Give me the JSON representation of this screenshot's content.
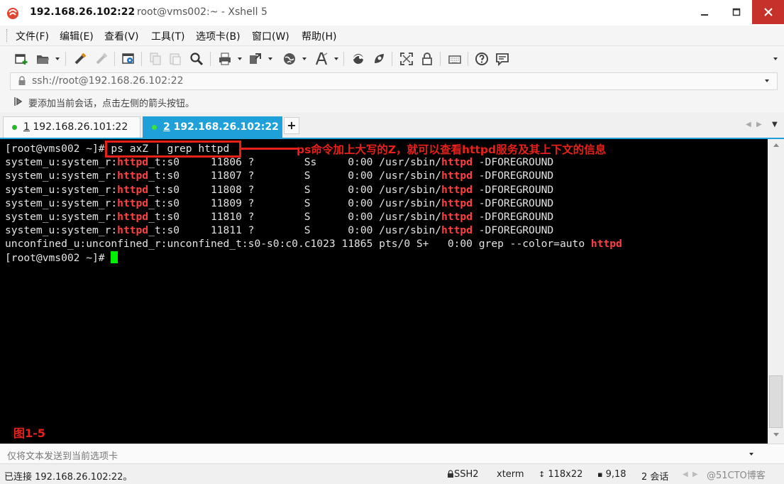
{
  "window": {
    "title_host": "192.168.26.102:22",
    "title_rest": "root@vms002:~ - Xshell 5",
    "brand_color": "#1fa0d8",
    "close_color": "#c7312b"
  },
  "menu": [
    "文件(F)",
    "编辑(E)",
    "查看(V)",
    "工具(T)",
    "选项卡(B)",
    "窗口(W)",
    "帮助(H)"
  ],
  "toolbar_icons": [
    "new-session-icon",
    "open-folder-icon",
    "reconnect-icon",
    "disconnect-icon",
    "properties-icon",
    "copy-icon",
    "paste-icon",
    "find-icon",
    "print-icon",
    "transfer-icon",
    "globe-icon",
    "font-icon",
    "xftp-icon",
    "xmanager-icon",
    "fullscreen-icon",
    "lock-icon",
    "keyboard-icon",
    "help-icon",
    "chat-icon"
  ],
  "address": {
    "value": "ssh://root@192.168.26.102:22",
    "hint": "要添加当前会话，点击左侧的箭头按钮。"
  },
  "tabs": [
    {
      "number": "1",
      "label": " 192.168.26.101:22",
      "active": false
    },
    {
      "number": "2",
      "label": " 192.168.26.102:22",
      "active": true
    }
  ],
  "terminal": {
    "lines": [
      {
        "pre": "[root@vms002 ~]# ps axZ | grep httpd",
        "hl": "",
        "post": ""
      },
      {
        "pre": "system_u:system_r:",
        "hl": "httpd",
        "post": "_t:s0     11806 ?        Ss     0:00 /usr/sbin/",
        "hl2": "httpd",
        "post2": " -DFOREGROUND"
      },
      {
        "pre": "system_u:system_r:",
        "hl": "httpd",
        "post": "_t:s0     11807 ?        S      0:00 /usr/sbin/",
        "hl2": "httpd",
        "post2": " -DFOREGROUND"
      },
      {
        "pre": "system_u:system_r:",
        "hl": "httpd",
        "post": "_t:s0     11808 ?        S      0:00 /usr/sbin/",
        "hl2": "httpd",
        "post2": " -DFOREGROUND"
      },
      {
        "pre": "system_u:system_r:",
        "hl": "httpd",
        "post": "_t:s0     11809 ?        S      0:00 /usr/sbin/",
        "hl2": "httpd",
        "post2": " -DFOREGROUND"
      },
      {
        "pre": "system_u:system_r:",
        "hl": "httpd",
        "post": "_t:s0     11810 ?        S      0:00 /usr/sbin/",
        "hl2": "httpd",
        "post2": " -DFOREGROUND"
      },
      {
        "pre": "system_u:system_r:",
        "hl": "httpd",
        "post": "_t:s0     11811 ?        S      0:00 /usr/sbin/",
        "hl2": "httpd",
        "post2": " -DFOREGROUND"
      },
      {
        "pre": "unconfined_u:unconfined_r:unconfined_t:s0-s0:c0.c1023 11865 pts/0 S+   0:00 grep --color=auto ",
        "hl": "httpd",
        "post": ""
      },
      {
        "pre": "[root@vms002 ~]# ",
        "hl": "",
        "post": "",
        "cursor": true
      }
    ],
    "annotation": "ps命令加上大写的Z，就可以查看httpd服务及其上下文的信息",
    "figure_label": "图1-5",
    "highlight_color": "#ff4040",
    "annotation_color": "#e8201a"
  },
  "send_bar": "仅将文本发送到当前选项卡",
  "status": {
    "connection": "已连接 192.168.26.102:22。",
    "protocol": "SSH2",
    "term": "xterm",
    "size": "118x22",
    "cursor_pos": "9,18",
    "sessions": "2 会话",
    "watermark": "@51CTO博客"
  }
}
